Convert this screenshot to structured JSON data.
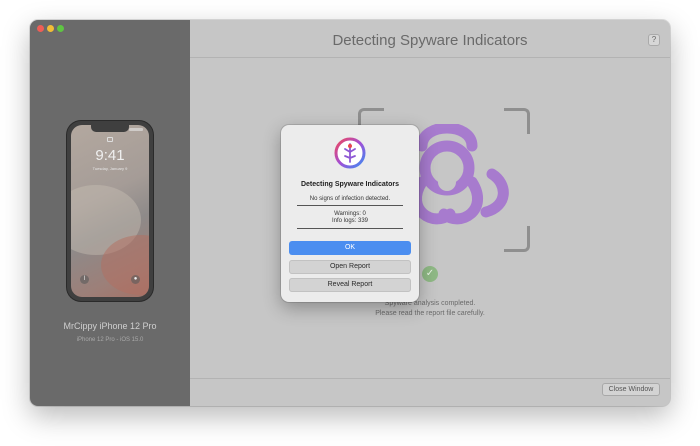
{
  "window": {
    "title": "Detecting Spyware Indicators",
    "help_label": "?"
  },
  "device": {
    "name": "MrCippy iPhone 12 Pro",
    "info": "iPhone 12 Pro - iOS 15.0",
    "lock_time": "9:41",
    "lock_date": "Tuesday, January 9"
  },
  "analysis": {
    "line1": "Spyware analysis completed.",
    "line2": "Please read the report file carefully."
  },
  "footer": {
    "close_window": "Close Window"
  },
  "dialog": {
    "title": "Detecting Spyware Indicators",
    "message": "No signs of infection detected.",
    "warnings": "Warnings: 0",
    "info_logs": "Info logs: 339",
    "ok": "OK",
    "open_report": "Open Report",
    "reveal_report": "Reveal Report"
  },
  "colors": {
    "accent": "#4b8ef0",
    "biohazard": "#a678cf",
    "success": "#8fb985"
  }
}
